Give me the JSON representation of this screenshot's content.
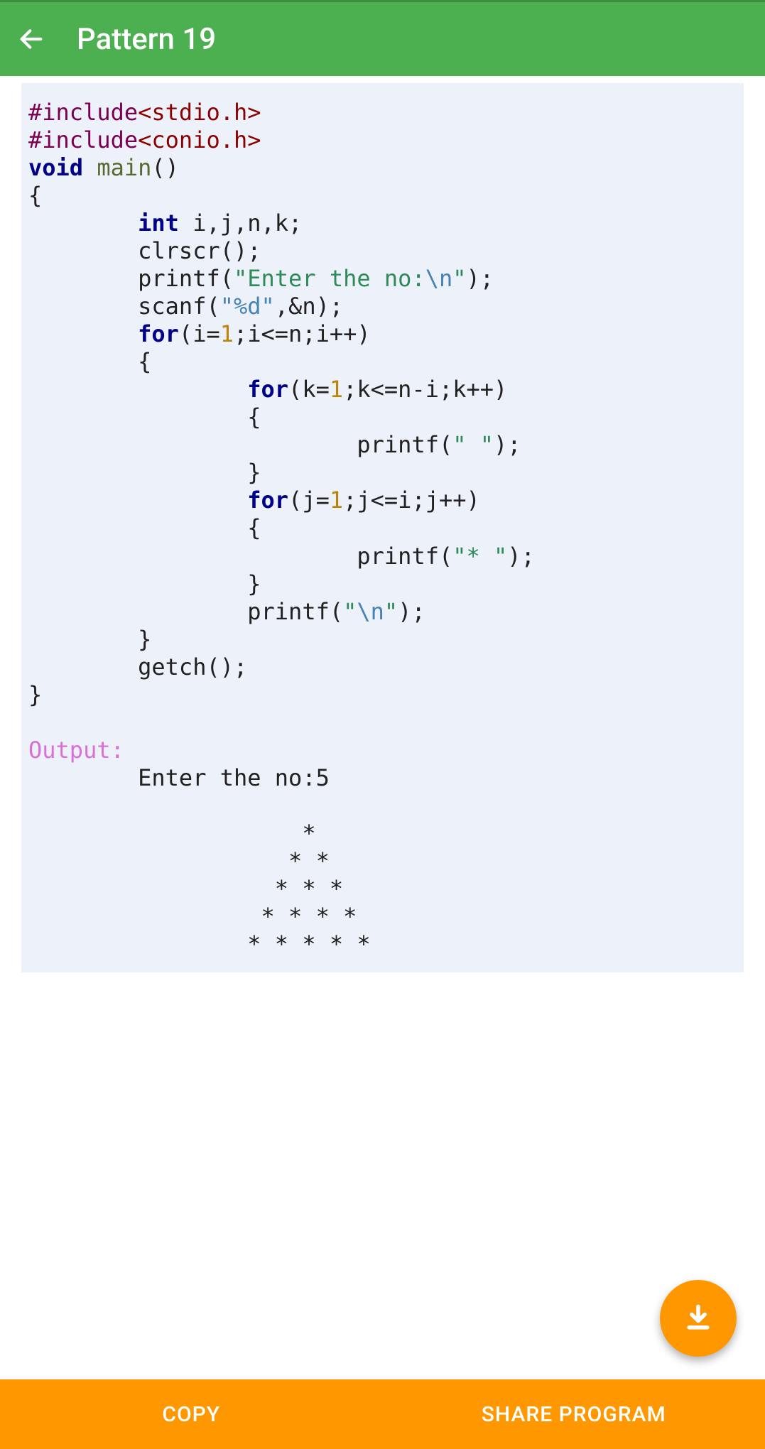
{
  "header": {
    "title": "Pattern 19"
  },
  "code": {
    "line1_hash": "#include",
    "line1_header": "<stdio.h>",
    "line2_hash": "#include",
    "line2_header": "<conio.h>",
    "void": "void",
    "main": "main",
    "int": "int",
    "vars": " i,j,n,k;",
    "clrscr": "clrscr",
    "printf": "printf",
    "scanf": "scanf",
    "getch": "getch",
    "for": "for",
    "enter_str": "\"Enter the no:",
    "nl": "\\n",
    "closeq": "\"",
    "pctd": "\"%d\"",
    "amp_n": ",&n",
    "i_eq_1": "i=",
    "one": "1",
    "semi": ";",
    "i_le_n": "i<=n;i++",
    "k_eq_1": "k=",
    "k_le": "k<=n-i;k++",
    "j_eq_1": "j=",
    "j_le_i": "j<=i;j++",
    "space_str": "\" \"",
    "star_str": "\"* \"",
    "nl_str": "\"\\n\"",
    "output_label": "Output:",
    "out_enter": "Enter the no:5",
    "out_row1": "    *",
    "out_row2": "   * *",
    "out_row3": "  * * *",
    "out_row4": " * * * *",
    "out_row5": "* * * * *"
  },
  "buttons": {
    "copy": "COPY",
    "share": "SHARE PROGRAM"
  }
}
